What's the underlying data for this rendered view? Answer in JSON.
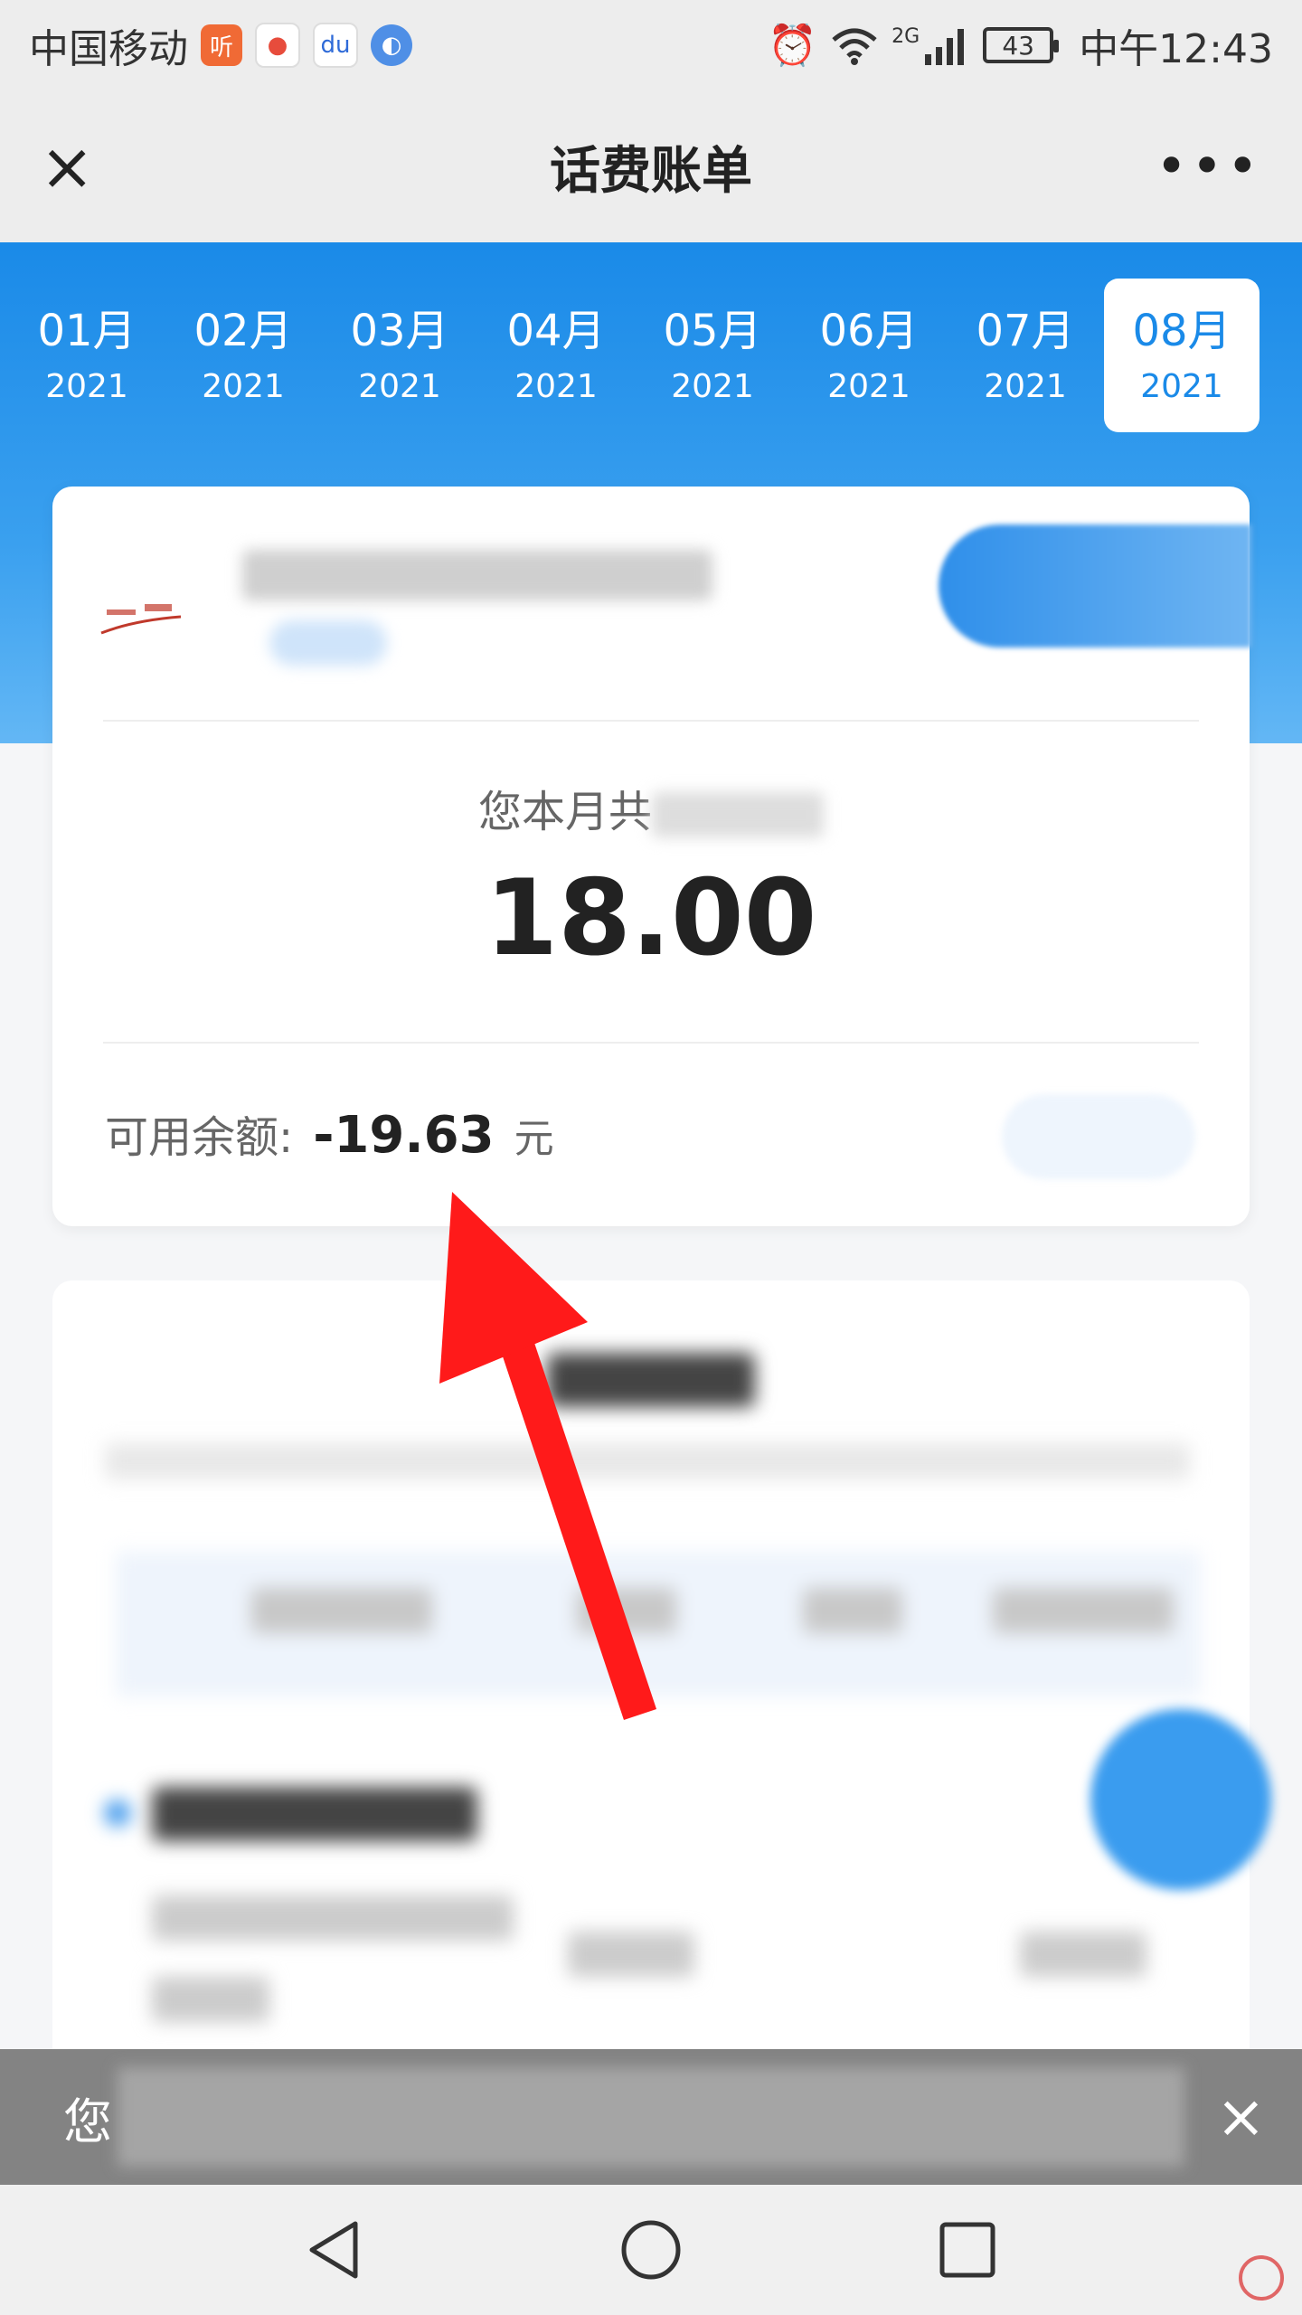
{
  "status_bar": {
    "carrier": "中国移动",
    "app_icons": [
      "listen-app-icon",
      "map-app-icon",
      "baidu-app-icon",
      "browser-app-icon"
    ],
    "listen_label": "听",
    "baidu_label": "du",
    "network": "2G",
    "battery": "43",
    "time": "中午12:43"
  },
  "navbar": {
    "close_icon": "×",
    "title": "话费账单",
    "more_icon": "•••"
  },
  "months": [
    {
      "month": "01月",
      "year": "2021",
      "active": false
    },
    {
      "month": "02月",
      "year": "2021",
      "active": false
    },
    {
      "month": "03月",
      "year": "2021",
      "active": false
    },
    {
      "month": "04月",
      "year": "2021",
      "active": false
    },
    {
      "month": "05月",
      "year": "2021",
      "active": false
    },
    {
      "month": "06月",
      "year": "2021",
      "active": false
    },
    {
      "month": "07月",
      "year": "2021",
      "active": false
    },
    {
      "month": "08月",
      "year": "2021",
      "active": true
    }
  ],
  "summary": {
    "spent_label": "您本月共",
    "spent_amount": "18.00",
    "balance_label": "可用余额:",
    "balance_value": "-19.63",
    "balance_unit": "元"
  },
  "toast": {
    "text": "您",
    "close_icon": "×"
  },
  "colors": {
    "brand_blue": "#1a8ae8",
    "arrow_red": "#ff1a1a"
  }
}
